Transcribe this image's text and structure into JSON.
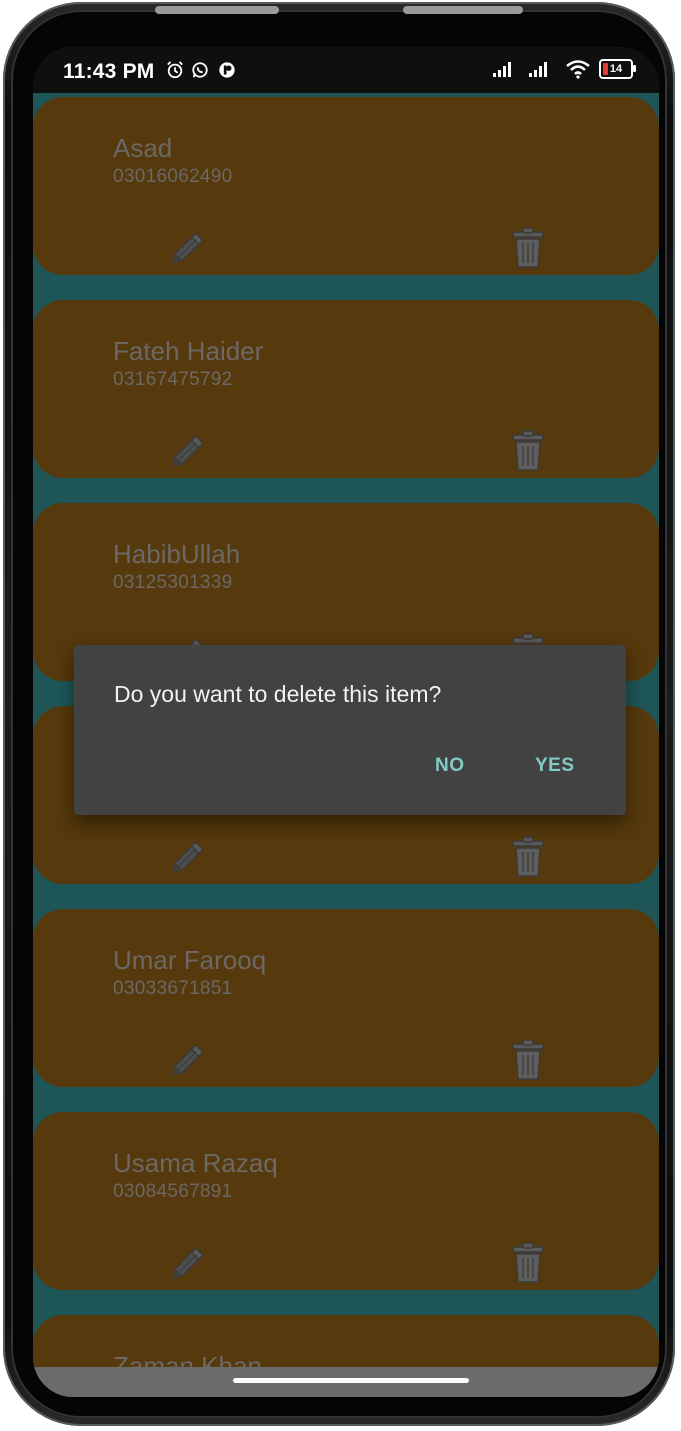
{
  "status_bar": {
    "time": "11:43 PM",
    "battery_level": "14",
    "icons": [
      "alarm-icon",
      "whatsapp-icon",
      "app-icon",
      "signal-icon",
      "signal-icon",
      "wifi-icon",
      "battery-icon"
    ]
  },
  "contacts": [
    {
      "name": "Asad",
      "phone": "03016062490"
    },
    {
      "name": "Fateh Haider",
      "phone": "03167475792"
    },
    {
      "name": "HabibUllah",
      "phone": "03125301339"
    },
    {
      "name": "",
      "phone": ""
    },
    {
      "name": "Umar Farooq",
      "phone": "03033671851"
    },
    {
      "name": "Usama Razaq",
      "phone": "03084567891"
    },
    {
      "name": "Zaman Khan",
      "phone": ""
    }
  ],
  "dialog": {
    "message": "Do you want to delete this item?",
    "no_label": "NO",
    "yes_label": "YES"
  },
  "colors": {
    "card": "#56390c",
    "list_background": "#1e5658",
    "dialog": "#424242",
    "dialog_button": "#80cbc4"
  }
}
